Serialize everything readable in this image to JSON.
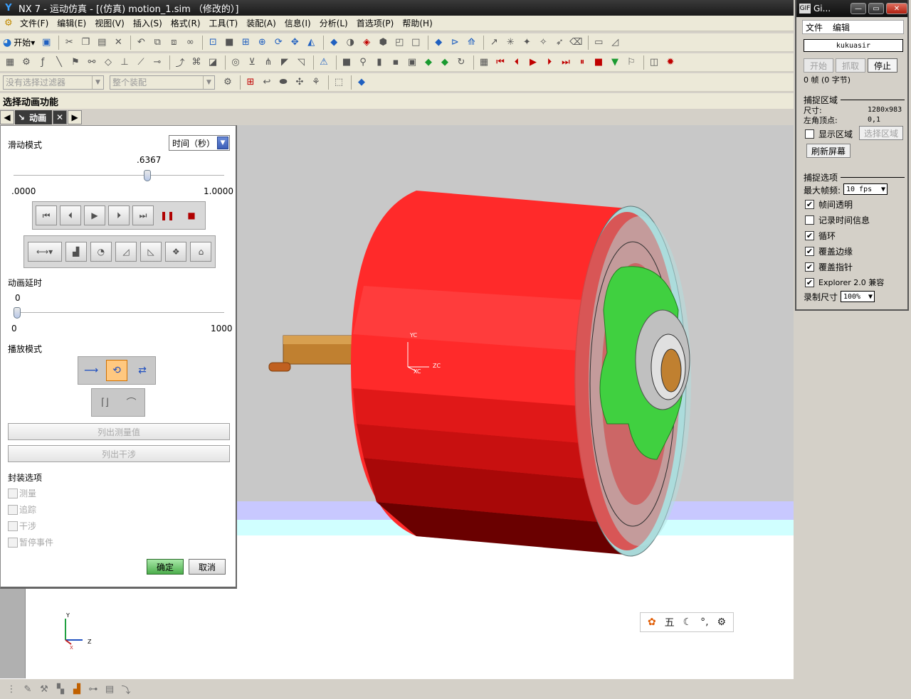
{
  "app": {
    "title": "NX 7 - 运动仿真 - [(仿真) motion_1.sim （修改的）]"
  },
  "menu": [
    "文件(F)",
    "编辑(E)",
    "视图(V)",
    "插入(S)",
    "格式(R)",
    "工具(T)",
    "装配(A)",
    "信息(I)",
    "分析(L)",
    "首选项(P)",
    "帮助(H)"
  ],
  "toolbar": {
    "start_label": "开始",
    "filter_placeholder": "没有选择过滤器",
    "assembly_placeholder": "整个装配"
  },
  "dialog": {
    "caption": "选择动画功能",
    "tab_label": "动画",
    "slide_mode_label": "滑动模式",
    "slide_mode_value": "时间（秒）",
    "slider_value": ".6367",
    "slider_fraction": 0.6367,
    "slider_min": ".0000",
    "slider_max": "1.0000",
    "delay_label": "动画延时",
    "delay_value": "0",
    "delay_min": "0",
    "delay_max": "1000",
    "play_mode_label": "播放模式",
    "list_measure_label": "列出测量值",
    "list_interference_label": "列出干涉",
    "package_label": "封装选项",
    "options": [
      "测量",
      "追踪",
      "干涉",
      "暂停事件"
    ],
    "ok_label": "确定",
    "cancel_label": "取消"
  },
  "viewport": {
    "wcs_y": "YC",
    "wcs_x": "XC",
    "wcs_z": "ZC",
    "abs_y": "Y",
    "abs_z": "Z",
    "abs_x": "X"
  },
  "gif": {
    "title": "Gi...",
    "menu": [
      "文件",
      "编辑"
    ],
    "name": "kukuasir",
    "start_label": "开始",
    "grab_label": "抓取",
    "stop_label": "停止",
    "frames_text": "0 帧 (0 字节)",
    "capture_area_label": "捕捉区域",
    "size_label": "尺寸:",
    "size_value": "1280x983",
    "corner_label": "左角顶点:",
    "corner_value": "0,1",
    "show_area_label": "显示区域",
    "select_area_label": "选择区域",
    "refresh_label": "刷新屏幕",
    "capture_opts_label": "捕捉选项",
    "max_fps_label": "最大帧频:",
    "max_fps_value": "10 fps",
    "checks": [
      {
        "label": "帧间透明",
        "checked": true
      },
      {
        "label": "记录时间信息",
        "checked": false
      },
      {
        "label": "循环",
        "checked": true
      },
      {
        "label": "覆盖边缘",
        "checked": true
      },
      {
        "label": "覆盖指针",
        "checked": true
      },
      {
        "label": "Explorer 2.0 兼容",
        "checked": true
      }
    ],
    "rec_size_label": "录制尺寸",
    "rec_size_value": "100%"
  },
  "ime": {
    "mode_char": "五"
  }
}
